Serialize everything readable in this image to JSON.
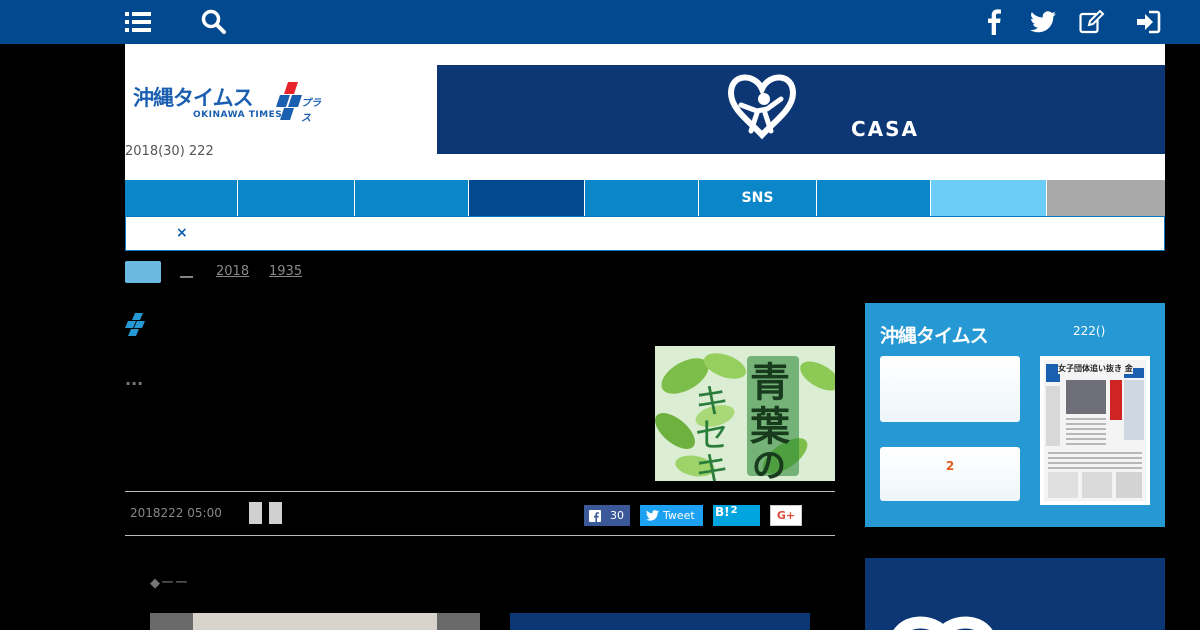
{
  "topbar": {
    "icons": [
      "menu-list-icon",
      "search-icon",
      "facebook-icon",
      "twitter-icon",
      "edit-icon",
      "login-icon"
    ],
    "color": "#03498f"
  },
  "header": {
    "logo_jp": "沖縄タイムス",
    "logo_plus": "プラス",
    "logo_en": "OKINAWA TIMES",
    "date_line": "2018(30) 222",
    "banner_text": "CASA"
  },
  "nav": {
    "items": [
      "",
      "",
      "",
      "",
      "",
      "SNS",
      "",
      "",
      ""
    ],
    "colors": [
      "#0b86c8",
      "#0b86c8",
      "#0b86c8",
      "#03498f",
      "#0b86c8",
      "#0b86c8",
      "#0b86c8",
      "#6ccef7",
      "#a8a8a8"
    ]
  },
  "subbar": {
    "close": "×"
  },
  "breadcrumb": {
    "home": "",
    "links": [
      "__",
      "2018",
      "1935"
    ]
  },
  "article": {
    "dots": "...",
    "thumb_text": [
      "青",
      "葉",
      "の",
      "キ",
      "セ",
      "キ"
    ],
    "date": "2018222 05:00",
    "share": {
      "facebook_count": "30",
      "tweet_label": "Tweet",
      "hatena_label": "B!",
      "hatena_count": "2",
      "google_label": "G+"
    },
    "quote_mark": "◆ーー"
  },
  "sidebar": {
    "title": "沖縄タイムス",
    "count": "222()",
    "card2_num": "2",
    "paper_headline": "女子団体追い抜き 金"
  }
}
